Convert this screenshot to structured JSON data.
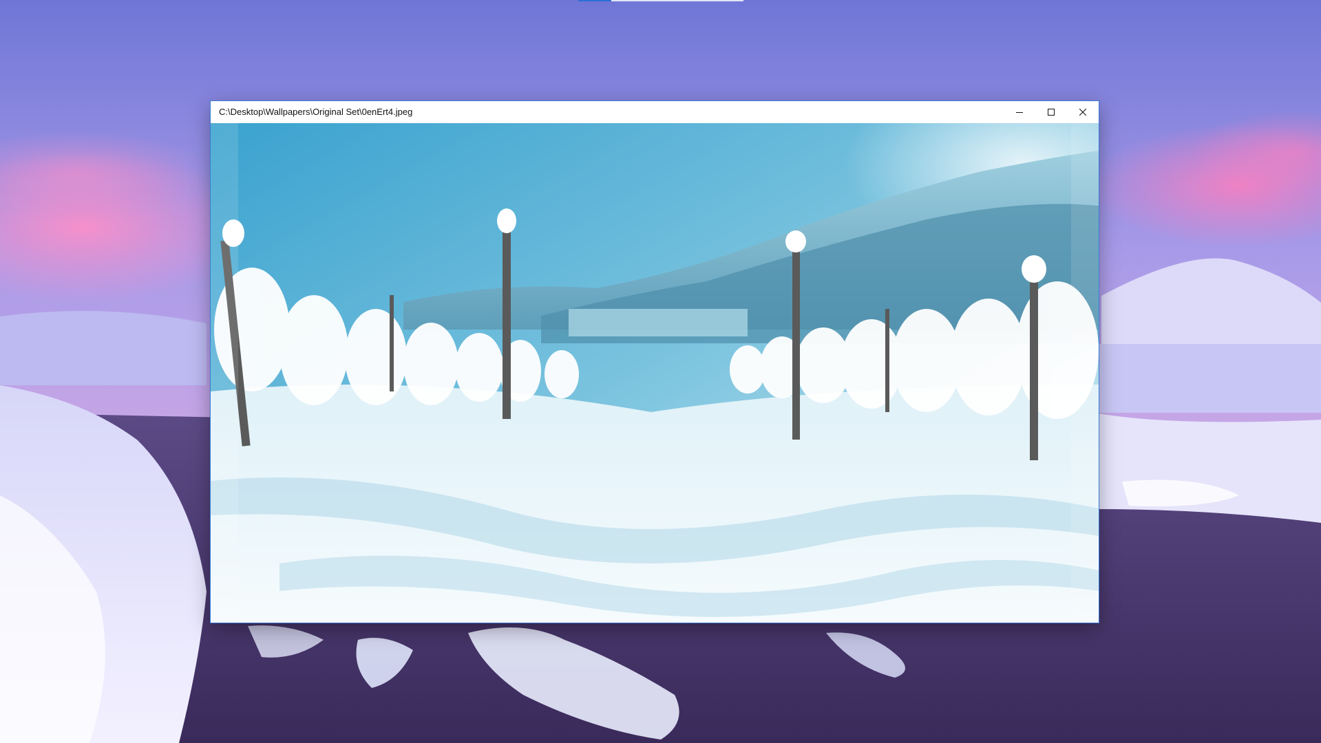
{
  "window": {
    "title": "C:\\Desktop\\Wallpapers\\Original Set\\0enErt4.jpeg",
    "controls": {
      "minimize": "minimize-icon",
      "maximize": "maximize-icon",
      "close": "close-icon"
    }
  },
  "colors": {
    "window_border": "#3a7bd5",
    "titlebar_bg": "#ffffff",
    "desktop_sky_top": "#7a7fd8",
    "desktop_sky_pink": "#e889c8",
    "desktop_snow": "#cfd3f6",
    "photo_sky": "#3a9ac7",
    "photo_snow": "#eef6fb"
  }
}
